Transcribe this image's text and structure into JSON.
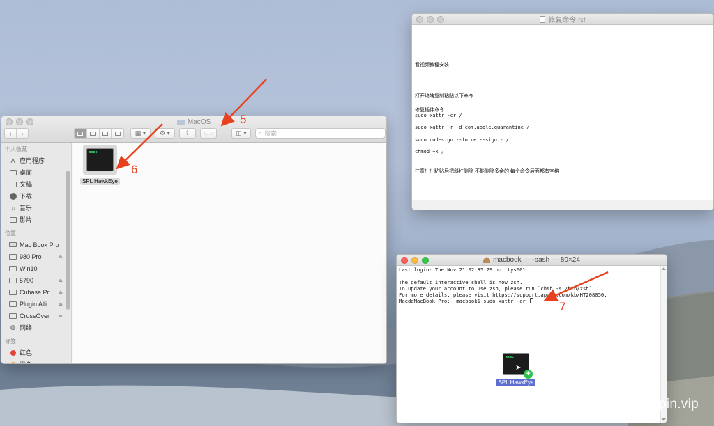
{
  "finder": {
    "title": "MacOS",
    "search_placeholder": "搜索",
    "sidebar": {
      "favorites_header": "个人收藏",
      "favorites": [
        {
          "label": "应用程序",
          "icon": "applications-icon"
        },
        {
          "label": "桌面",
          "icon": "desktop-icon"
        },
        {
          "label": "文稿",
          "icon": "documents-icon"
        },
        {
          "label": "下载",
          "icon": "downloads-icon"
        },
        {
          "label": "音乐",
          "icon": "music-icon"
        },
        {
          "label": "影片",
          "icon": "movies-icon"
        }
      ],
      "locations_header": "位置",
      "locations": [
        {
          "label": "Mac Book Pro",
          "icon": "computer-icon"
        },
        {
          "label": "980 Pro",
          "icon": "drive-icon"
        },
        {
          "label": "Win10",
          "icon": "drive-icon"
        },
        {
          "label": "5790",
          "icon": "drive-icon"
        },
        {
          "label": "Cubase Pr...",
          "icon": "drive-icon"
        },
        {
          "label": "Plugin Alli...",
          "icon": "drive-icon"
        },
        {
          "label": "CrossOver",
          "icon": "drive-icon"
        },
        {
          "label": "网络",
          "icon": "network-icon"
        }
      ],
      "tags_header": "标签",
      "tags": [
        {
          "label": "红色",
          "color": "#e2453c"
        },
        {
          "label": "橙色",
          "color": "#f39a2b"
        }
      ]
    },
    "file": {
      "name": "SPL HawkEye",
      "icon_text": "exec"
    }
  },
  "textedit": {
    "title": "修复命令.txt",
    "lines": [
      "看视频教程安装",
      "打开终端复制粘贴以下命令",
      "修复插件命令",
      "sudo xattr -cr /",
      "sudo xattr -r -d com.apple.quarantine /",
      "sudo codesign --force --sign - /",
      "chmod +x /",
      "注意！！粘贴后把斜杠删除 不能删除多余的 每个命令后面都有空格"
    ]
  },
  "terminal": {
    "title": "macbook — -bash — 80×24",
    "lines": [
      "Last login: Tue Nov 21 02:35:29 on ttys001",
      "",
      "The default interactive shell is now zsh.",
      "To update your account to use zsh, please run `chsh -s /bin/zsh`.",
      "For more details, please visit https://support.apple.com/kb/HT208050.",
      "MacdeMacBook-Pro:~ macbook$ sudo xattr -cr "
    ],
    "drag_item": {
      "name": "SPL HawkEye",
      "icon_text": "exec",
      "badge": "+"
    }
  },
  "annotations": {
    "markers": [
      "5",
      "6",
      "7"
    ],
    "color": "#e8411e"
  },
  "watermark": "Shuziyinpin.vip"
}
